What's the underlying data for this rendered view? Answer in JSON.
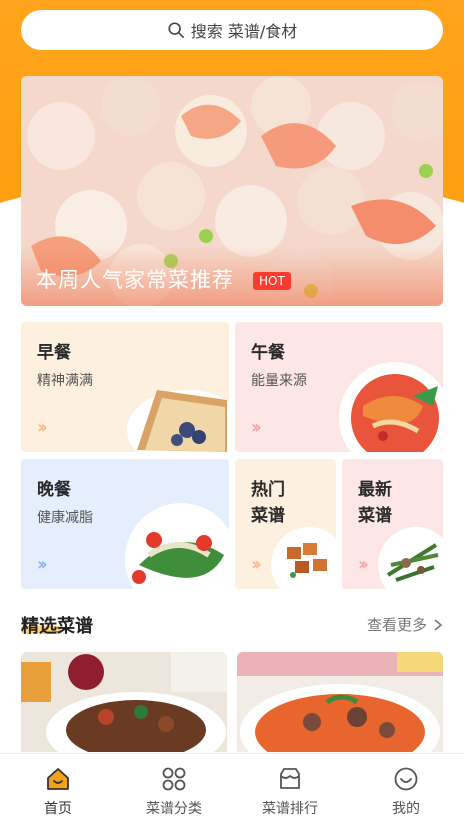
{
  "search": {
    "placeholder": "搜索 菜谱/食材",
    "icon": "search-icon"
  },
  "banner": {
    "title": "本周人气家常菜推荐",
    "badge": "HOT"
  },
  "categories": [
    {
      "title": "早餐",
      "subtitle": "精神满满"
    },
    {
      "title": "午餐",
      "subtitle": "能量来源"
    },
    {
      "title": "晚餐",
      "subtitle": "健康减脂"
    },
    {
      "title_line1": "热门",
      "title_line2": "菜谱"
    },
    {
      "title_line1": "最新",
      "title_line2": "菜谱"
    }
  ],
  "section": {
    "title": "精选菜谱",
    "more": "查看更多"
  },
  "tabs": [
    {
      "label": "首页",
      "icon": "home-icon",
      "active": true
    },
    {
      "label": "菜谱分类",
      "icon": "category-grid-icon",
      "active": false
    },
    {
      "label": "菜谱排行",
      "icon": "ranking-icon",
      "active": false
    },
    {
      "label": "我的",
      "icon": "profile-smile-icon",
      "active": false
    }
  ],
  "colors": {
    "accent": "#ffa41c",
    "hot_badge": "#ff3b30",
    "tab_active": "#f5a21b"
  }
}
